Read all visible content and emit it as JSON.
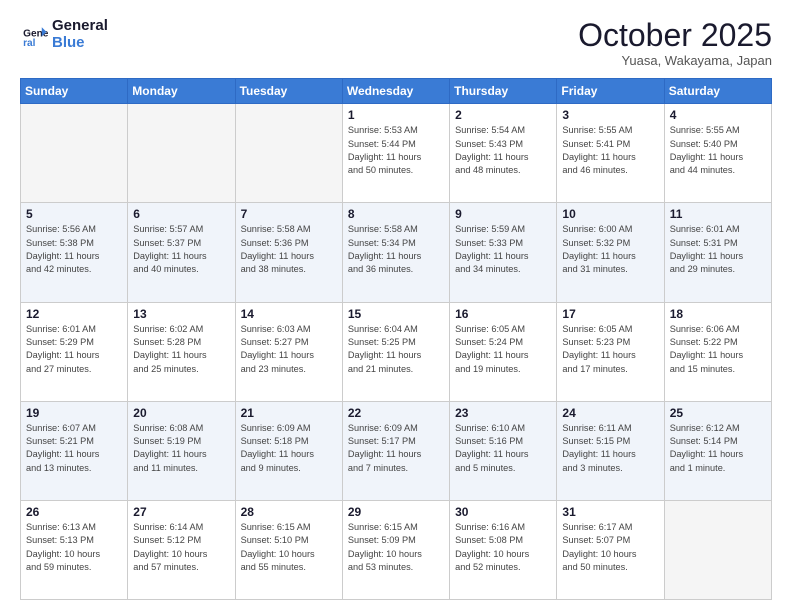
{
  "logo": {
    "line1": "General",
    "line2": "Blue"
  },
  "title": "October 2025",
  "subtitle": "Yuasa, Wakayama, Japan",
  "weekdays": [
    "Sunday",
    "Monday",
    "Tuesday",
    "Wednesday",
    "Thursday",
    "Friday",
    "Saturday"
  ],
  "weeks": [
    [
      {
        "day": "",
        "info": ""
      },
      {
        "day": "",
        "info": ""
      },
      {
        "day": "",
        "info": ""
      },
      {
        "day": "1",
        "info": "Sunrise: 5:53 AM\nSunset: 5:44 PM\nDaylight: 11 hours\nand 50 minutes."
      },
      {
        "day": "2",
        "info": "Sunrise: 5:54 AM\nSunset: 5:43 PM\nDaylight: 11 hours\nand 48 minutes."
      },
      {
        "day": "3",
        "info": "Sunrise: 5:55 AM\nSunset: 5:41 PM\nDaylight: 11 hours\nand 46 minutes."
      },
      {
        "day": "4",
        "info": "Sunrise: 5:55 AM\nSunset: 5:40 PM\nDaylight: 11 hours\nand 44 minutes."
      }
    ],
    [
      {
        "day": "5",
        "info": "Sunrise: 5:56 AM\nSunset: 5:38 PM\nDaylight: 11 hours\nand 42 minutes."
      },
      {
        "day": "6",
        "info": "Sunrise: 5:57 AM\nSunset: 5:37 PM\nDaylight: 11 hours\nand 40 minutes."
      },
      {
        "day": "7",
        "info": "Sunrise: 5:58 AM\nSunset: 5:36 PM\nDaylight: 11 hours\nand 38 minutes."
      },
      {
        "day": "8",
        "info": "Sunrise: 5:58 AM\nSunset: 5:34 PM\nDaylight: 11 hours\nand 36 minutes."
      },
      {
        "day": "9",
        "info": "Sunrise: 5:59 AM\nSunset: 5:33 PM\nDaylight: 11 hours\nand 34 minutes."
      },
      {
        "day": "10",
        "info": "Sunrise: 6:00 AM\nSunset: 5:32 PM\nDaylight: 11 hours\nand 31 minutes."
      },
      {
        "day": "11",
        "info": "Sunrise: 6:01 AM\nSunset: 5:31 PM\nDaylight: 11 hours\nand 29 minutes."
      }
    ],
    [
      {
        "day": "12",
        "info": "Sunrise: 6:01 AM\nSunset: 5:29 PM\nDaylight: 11 hours\nand 27 minutes."
      },
      {
        "day": "13",
        "info": "Sunrise: 6:02 AM\nSunset: 5:28 PM\nDaylight: 11 hours\nand 25 minutes."
      },
      {
        "day": "14",
        "info": "Sunrise: 6:03 AM\nSunset: 5:27 PM\nDaylight: 11 hours\nand 23 minutes."
      },
      {
        "day": "15",
        "info": "Sunrise: 6:04 AM\nSunset: 5:25 PM\nDaylight: 11 hours\nand 21 minutes."
      },
      {
        "day": "16",
        "info": "Sunrise: 6:05 AM\nSunset: 5:24 PM\nDaylight: 11 hours\nand 19 minutes."
      },
      {
        "day": "17",
        "info": "Sunrise: 6:05 AM\nSunset: 5:23 PM\nDaylight: 11 hours\nand 17 minutes."
      },
      {
        "day": "18",
        "info": "Sunrise: 6:06 AM\nSunset: 5:22 PM\nDaylight: 11 hours\nand 15 minutes."
      }
    ],
    [
      {
        "day": "19",
        "info": "Sunrise: 6:07 AM\nSunset: 5:21 PM\nDaylight: 11 hours\nand 13 minutes."
      },
      {
        "day": "20",
        "info": "Sunrise: 6:08 AM\nSunset: 5:19 PM\nDaylight: 11 hours\nand 11 minutes."
      },
      {
        "day": "21",
        "info": "Sunrise: 6:09 AM\nSunset: 5:18 PM\nDaylight: 11 hours\nand 9 minutes."
      },
      {
        "day": "22",
        "info": "Sunrise: 6:09 AM\nSunset: 5:17 PM\nDaylight: 11 hours\nand 7 minutes."
      },
      {
        "day": "23",
        "info": "Sunrise: 6:10 AM\nSunset: 5:16 PM\nDaylight: 11 hours\nand 5 minutes."
      },
      {
        "day": "24",
        "info": "Sunrise: 6:11 AM\nSunset: 5:15 PM\nDaylight: 11 hours\nand 3 minutes."
      },
      {
        "day": "25",
        "info": "Sunrise: 6:12 AM\nSunset: 5:14 PM\nDaylight: 11 hours\nand 1 minute."
      }
    ],
    [
      {
        "day": "26",
        "info": "Sunrise: 6:13 AM\nSunset: 5:13 PM\nDaylight: 10 hours\nand 59 minutes."
      },
      {
        "day": "27",
        "info": "Sunrise: 6:14 AM\nSunset: 5:12 PM\nDaylight: 10 hours\nand 57 minutes."
      },
      {
        "day": "28",
        "info": "Sunrise: 6:15 AM\nSunset: 5:10 PM\nDaylight: 10 hours\nand 55 minutes."
      },
      {
        "day": "29",
        "info": "Sunrise: 6:15 AM\nSunset: 5:09 PM\nDaylight: 10 hours\nand 53 minutes."
      },
      {
        "day": "30",
        "info": "Sunrise: 6:16 AM\nSunset: 5:08 PM\nDaylight: 10 hours\nand 52 minutes."
      },
      {
        "day": "31",
        "info": "Sunrise: 6:17 AM\nSunset: 5:07 PM\nDaylight: 10 hours\nand 50 minutes."
      },
      {
        "day": "",
        "info": ""
      }
    ]
  ]
}
